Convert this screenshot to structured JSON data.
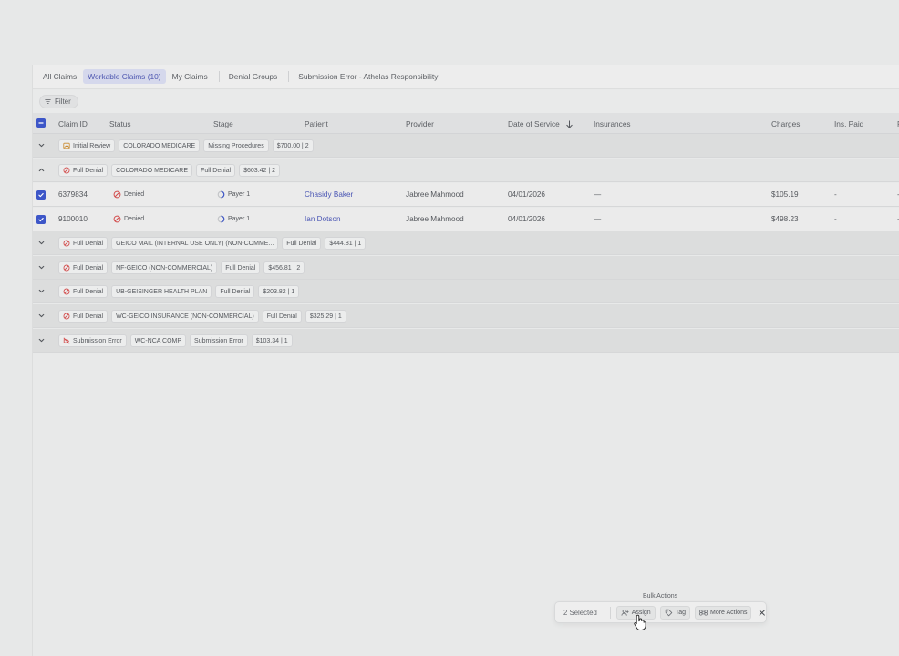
{
  "tabs": [
    {
      "label": "All Claims"
    },
    {
      "label": "Workable Claims (10)"
    },
    {
      "label": "My Claims"
    },
    {
      "label": "Denial Groups"
    },
    {
      "label": "Submission Error - Athelas Responsibility"
    }
  ],
  "filter": {
    "label": "Filter"
  },
  "columns": {
    "claim_id": "Claim ID",
    "status": "Status",
    "stage": "Stage",
    "patient": "Patient",
    "provider": "Provider",
    "dos": "Date of Service",
    "insurances": "Insurances",
    "charges": "Charges",
    "ins_paid": "Ins. Paid",
    "next": "F"
  },
  "groups": [
    {
      "status": "Initial Review",
      "payer": "COLORADO MEDICARE",
      "reason": "Missing Procedures",
      "summary": "$700.00 | 2"
    },
    {
      "status": "Full Denial",
      "payer": "COLORADO MEDICARE",
      "reason": "Full Denial",
      "summary": "$603.42 | 2"
    },
    {
      "status": "Full Denial",
      "payer": "GEICO MAIL (INTERNAL USE ONLY) (NON-COMME...",
      "reason": "Full Denial",
      "summary": "$444.81 | 1"
    },
    {
      "status": "Full Denial",
      "payer": "NF-GEICO (NON-COMMERCIAL)",
      "reason": "Full Denial",
      "summary": "$456.81 | 2"
    },
    {
      "status": "Full Denial",
      "payer": "UB-GEISINGER HEALTH PLAN",
      "reason": "Full Denial",
      "summary": "$203.82 | 1"
    },
    {
      "status": "Full Denial",
      "payer": "WC-GEICO INSURANCE (NON-COMMERCIAL)",
      "reason": "Full Denial",
      "summary": "$325.29 | 1"
    },
    {
      "status": "Submission Error",
      "payer": "WC-NCA COMP",
      "reason": "Submission Error",
      "summary": "$103.34 | 1"
    }
  ],
  "claims": [
    {
      "id": "6379834",
      "status": "Denied",
      "stage": "Payer 1",
      "patient": "Chasidy Baker",
      "provider": "Jabree Mahmood",
      "dos": "04/01/2026",
      "insurances": "—",
      "charges": "$105.19",
      "ins_paid": "-",
      "next": "-"
    },
    {
      "id": "9100010",
      "status": "Denied",
      "stage": "Payer 1",
      "patient": "Ian Dotson",
      "provider": "Jabree Mahmood",
      "dos": "04/01/2026",
      "insurances": "—",
      "charges": "$498.23",
      "ins_paid": "-",
      "next": "-"
    }
  ],
  "bulk": {
    "title": "Bulk Actions",
    "count": "2 Selected",
    "assign": "Assign",
    "tag": "Tag",
    "more": "More Actions"
  },
  "colors": {
    "accent": "#3d56c8",
    "link": "#4a56b4",
    "active_tab_bg": "#d5d8ec",
    "denied": "#d24b4b"
  },
  "icons": [
    "filter-icon",
    "checkbox-checked-icon",
    "checkbox-indeterminate-icon",
    "chevron-down-icon",
    "chevron-up-icon",
    "denied-icon",
    "image-icon",
    "progress-ring-icon",
    "submission-error-icon",
    "assign-user-icon",
    "tag-icon",
    "command-icon",
    "close-icon",
    "hand-cursor-icon",
    "sort-arrow-down-icon"
  ]
}
